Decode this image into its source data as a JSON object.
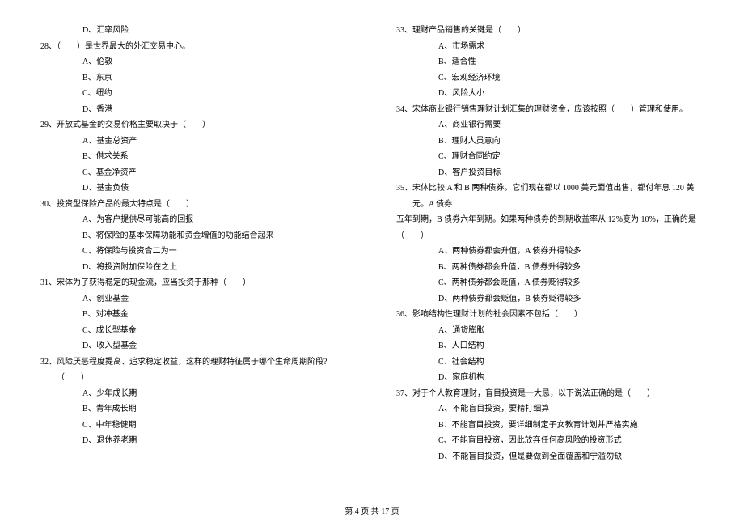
{
  "left_column": {
    "orphan_option": "D、汇率风险",
    "q28": {
      "text": "28、（　　）是世界最大的外汇交易中心。",
      "options": [
        "A、伦敦",
        "B、东京",
        "C、纽约",
        "D、香港"
      ]
    },
    "q29": {
      "text": "29、开放式基金的交易价格主要取决于（　　）",
      "options": [
        "A、基金总资产",
        "B、供求关系",
        "C、基金净资产",
        "D、基金负债"
      ]
    },
    "q30": {
      "text": "30、投资型保险产品的最大特点是（　　）",
      "options": [
        "A、为客户提供尽可能高的回报",
        "B、将保险的基本保障功能和资金增值的功能结合起来",
        "C、将保险与投资合二为一",
        "D、将投资附加保险在之上"
      ]
    },
    "q31": {
      "text": "31、宋体为了获得稳定的现金流，应当投资于那种（　　）",
      "options": [
        "A、创业基金",
        "B、对冲基金",
        "C、成长型基金",
        "D、收入型基金"
      ]
    },
    "q32": {
      "text": "32、风险厌恶程度提高、追求稳定收益，这样的理财特征属于哪个生命周期阶段?（　　）",
      "options": [
        "A、少年成长期",
        "B、青年成长期",
        "C、中年稳健期",
        "D、退休养老期"
      ]
    }
  },
  "right_column": {
    "q33": {
      "text": "33、理财产品销售的关键是（　　）",
      "options": [
        "A、市场需求",
        "B、适合性",
        "C、宏观经济环境",
        "D、风险大小"
      ]
    },
    "q34": {
      "text": "34、宋体商业银行销售理财计划汇集的理财资金，应该按照（　　）管理和使用。",
      "options": [
        "A、商业银行需要",
        "B、理财人员意向",
        "C、理财合同约定",
        "D、客户投资目标"
      ]
    },
    "q35": {
      "text": "35、宋体比较 A 和 B 两种债券。它们现在都以 1000 美元面值出售，都付年息 120 美元。A 债券",
      "continuation": "五年到期，B 债券六年到期。如果两种债券的到期收益率从 12%变为 10%，正确的是（　　）",
      "options": [
        "A、两种债券都会升值，A 债券升得较多",
        "B、两种债券都会升值，B 债券升得较多",
        "C、两种债券都会贬值，A 债券贬得较多",
        "D、两种债券都会贬值，B 债券贬得较多"
      ]
    },
    "q36": {
      "text": "36、影响结构性理财计划的社会因素不包括（　　）",
      "options": [
        "A、通货膨胀",
        "B、人口结构",
        "C、社会结构",
        "D、家庭机构"
      ]
    },
    "q37": {
      "text": "37、对于个人教育理财，盲目投资是一大忌，以下说法正确的是（　　）",
      "options": [
        "A、不能盲目投资，要精打细算",
        "B、不能盲目投资，要详细制定子女教育计划并严格实施",
        "C、不能盲目投资，因此放弃任何高风险的投资形式",
        "D、不能盲目投资，但是要做到全面覆盖和宁滥勿缺"
      ]
    }
  },
  "footer": "第 4 页 共 17 页"
}
